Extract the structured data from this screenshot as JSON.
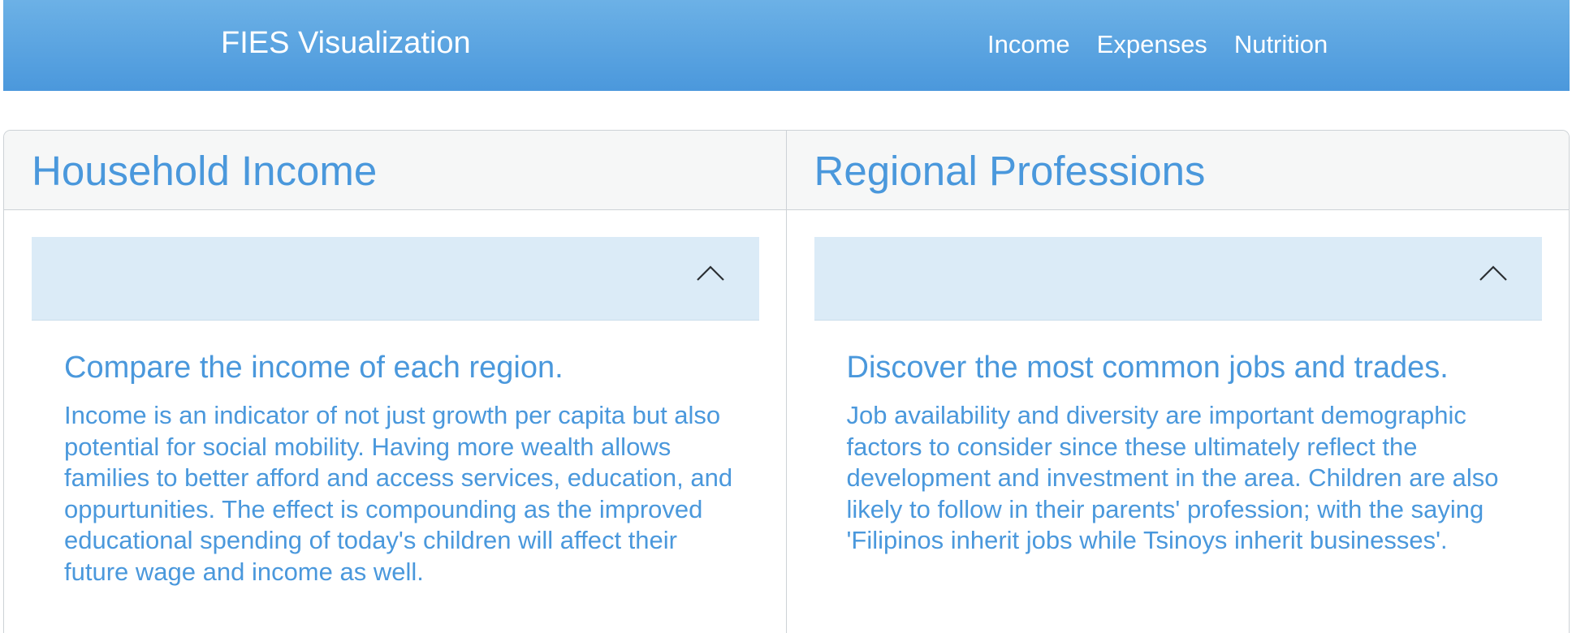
{
  "navbar": {
    "brand": "FIES Visualization",
    "links": [
      "Income",
      "Expenses",
      "Nutrition"
    ]
  },
  "panels": [
    {
      "title": "Household Income",
      "heading": "Compare the income of each region.",
      "body": "Income is an indicator of not just growth per capita but also potential for social mobility. Having more wealth allows families to better afford and access services, education, and oppurtunities. The effect is compounding as the improved educational spending of today's children will affect their future wage and income as well.",
      "accordion_icon": "chevron-up-icon"
    },
    {
      "title": "Regional Professions",
      "heading": "Discover the most common jobs and trades.",
      "body": "Job availability and diversity are important demographic factors to consider since these ultimately reflect the development and investment in the area. Children are also likely to follow in their parents' profession; with the saying 'Filipinos inherit jobs while Tsinoys inherit businesses'.",
      "accordion_icon": "chevron-up-icon"
    }
  ],
  "colors": {
    "navbar_top": "#6cb1e6",
    "navbar_bottom": "#4b98dc",
    "accent_text": "#4a98dc",
    "accordion_bg": "#dbebf7",
    "panel_header_bg": "#f6f7f7",
    "border": "#cdd2d6"
  }
}
